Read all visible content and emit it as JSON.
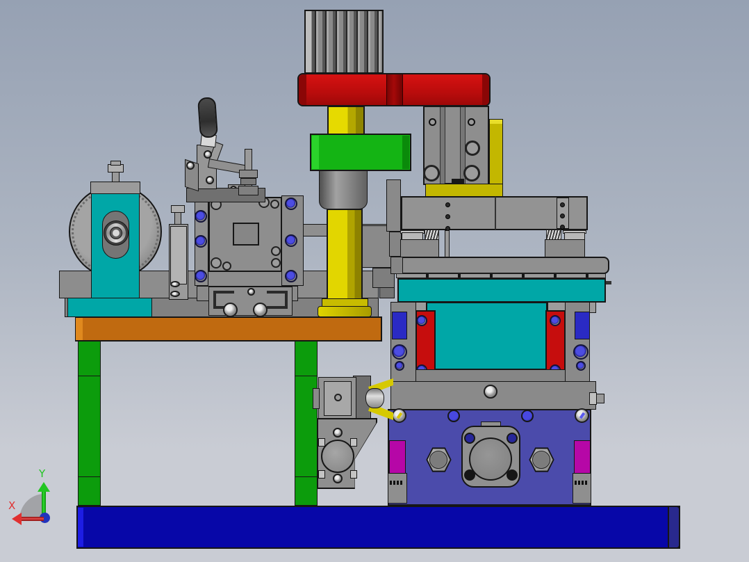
{
  "viewport": {
    "type": "3d-cad-assembly-view",
    "description": "Side elevation of a machine fixture assembly rendered in a CAD viewport"
  },
  "axis_triad": {
    "x_label": "X",
    "y_label": "Y"
  },
  "palette": {
    "bg_top": "#96a1b3",
    "bg_mid": "#adb5c2",
    "bg_bottom": "#c9ccd4",
    "outline": "#161616",
    "steel": "#8f8f8f",
    "steel_dark": "#6f6f6f",
    "steel_light": "#bdbdbd",
    "base_blue": "#0707a8",
    "base_blue_edge": "#1d1de4",
    "base_blue_cap": "#29298e",
    "leg_green": "#0c9c0c",
    "table_orange": "#c06a10",
    "table_orange_edge": "#e0891e",
    "teal": "#00a7a7",
    "red": "#c60d0d",
    "red_dark": "#8a0606",
    "yellow": "#d6c900",
    "yellow_dark": "#a39700",
    "green_block": "#14b414",
    "purple": "#4b4bab",
    "magenta": "#b607a7",
    "screw_blue": "#2a2ac4",
    "axis_x": "#e03030",
    "axis_y": "#22c522"
  },
  "parts": [
    {
      "name": "base-plate",
      "color": "base_blue"
    },
    {
      "name": "machine-table-top",
      "color": "table_orange"
    },
    {
      "name": "table-leg",
      "color": "leg_green"
    },
    {
      "name": "idler-wheel",
      "color": "steel"
    },
    {
      "name": "wheel-pedestal",
      "color": "teal"
    },
    {
      "name": "support-stand",
      "color": "steel"
    },
    {
      "name": "center-fixture-plate",
      "color": "steel"
    },
    {
      "name": "vertical-toggle-clamp",
      "color": "steel_dark"
    },
    {
      "name": "ribbed-adjustment-knob",
      "color": "steel"
    },
    {
      "name": "cross-head",
      "color": "red"
    },
    {
      "name": "lead-screw",
      "color": "yellow"
    },
    {
      "name": "clamp-block",
      "color": "green_block"
    },
    {
      "name": "guide-bushing",
      "color": "steel"
    },
    {
      "name": "guided-air-cylinder",
      "color": "steel"
    },
    {
      "name": "angle-bracket",
      "color": "yellow"
    },
    {
      "name": "floating-beam",
      "color": "steel"
    },
    {
      "name": "spring-support",
      "color": "steel"
    },
    {
      "name": "workpiece-block",
      "color": "teal"
    },
    {
      "name": "clamp-bar",
      "color": "red"
    },
    {
      "name": "actuator-body",
      "color": "purple"
    },
    {
      "name": "cylinder-flange",
      "color": "steel"
    },
    {
      "name": "hex-nut",
      "color": "steel"
    },
    {
      "name": "side-plate",
      "color": "magenta"
    },
    {
      "name": "roller-cam-bracket",
      "color": "steel"
    },
    {
      "name": "cam-wedge",
      "color": "yellow"
    },
    {
      "name": "coordinate-triad",
      "color": "axis"
    }
  ]
}
